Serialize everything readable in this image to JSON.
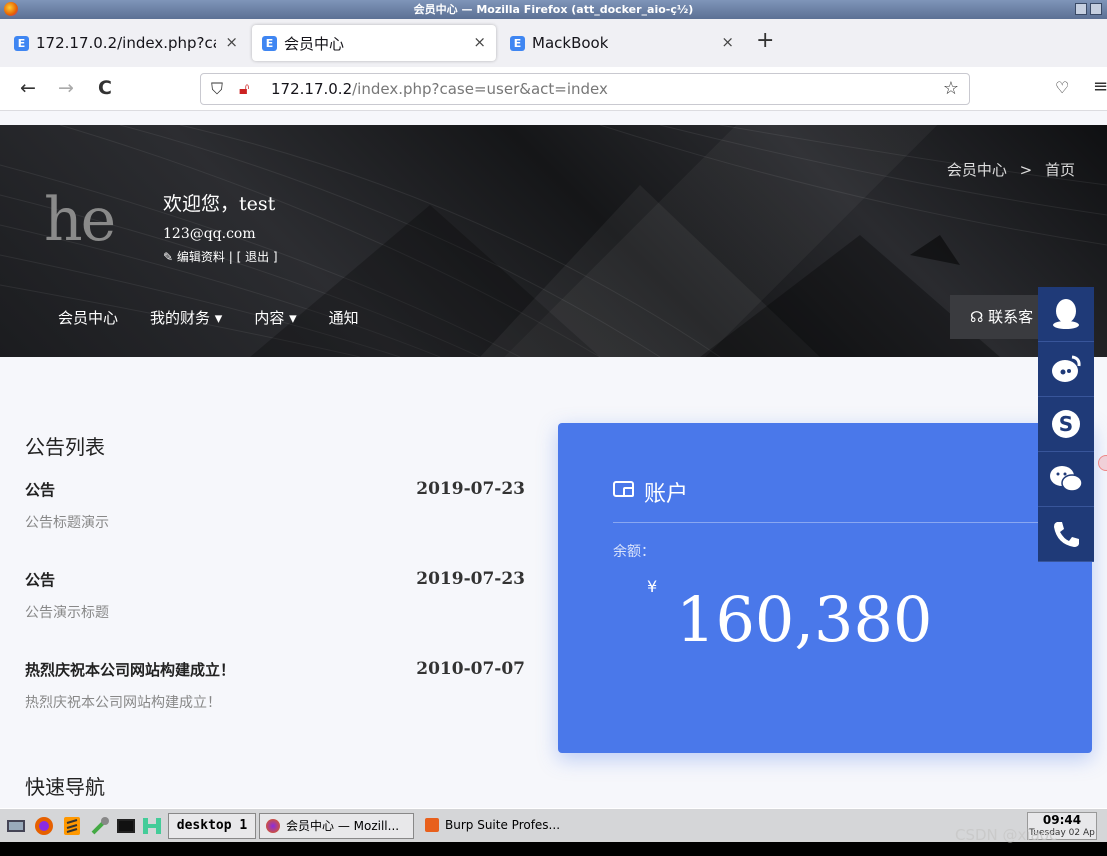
{
  "window": {
    "title": "会员中心 — Mozilla Firefox (att_docker_aio-ç½)"
  },
  "tabs": [
    {
      "label": "172.17.0.2/index.php?ca",
      "close": "×"
    },
    {
      "label": "会员中心",
      "close": "×"
    },
    {
      "label": "MackBook",
      "close": "×"
    }
  ],
  "toolbar": {
    "back": "←",
    "forward": "→",
    "reload": "C",
    "newtab": "+"
  },
  "urlbar": {
    "host": "172.17.0.2",
    "path": "/index.php?case=user&act=index"
  },
  "header": {
    "logo_text": "he",
    "welcome": "欢迎您，test",
    "email": "123@qq.com",
    "edit_profile": "编辑资料",
    "separator": "|",
    "logout": "[ 退出 ]",
    "breadcrumb": [
      "会员中心",
      ">",
      "首页"
    ],
    "nav": [
      "会员中心",
      "我的财务 ▾",
      "内容 ▾",
      "通知"
    ],
    "contact": "联系客"
  },
  "announcements": {
    "title": "公告列表",
    "items": [
      {
        "title": "公告",
        "date": "2019-07-23",
        "summary": "公告标题演示"
      },
      {
        "title": "公告",
        "date": "2019-07-23",
        "summary": "公告演示标题"
      },
      {
        "title": "热烈庆祝本公司网站构建成立！",
        "date": "2010-07-07",
        "summary": "热烈庆祝本公司网站构建成立！"
      }
    ]
  },
  "quick_nav": {
    "title": "快速导航"
  },
  "account": {
    "title": "账户",
    "balance_label": "余额：",
    "currency": "¥",
    "balance": "160,380",
    "color": "#4a78ea"
  },
  "side_tools": [
    "qq-icon",
    "weibo-icon",
    "skype-icon",
    "wechat-icon",
    "phone-icon"
  ],
  "taskbar": {
    "desktop": "desktop 1",
    "tasks": [
      "会员中心 — Mozill...",
      "Burp Suite Profes..."
    ],
    "time": "09:44",
    "date": "Tuesday 02 Ap"
  },
  "watermark": "CSDN @xiaoc"
}
